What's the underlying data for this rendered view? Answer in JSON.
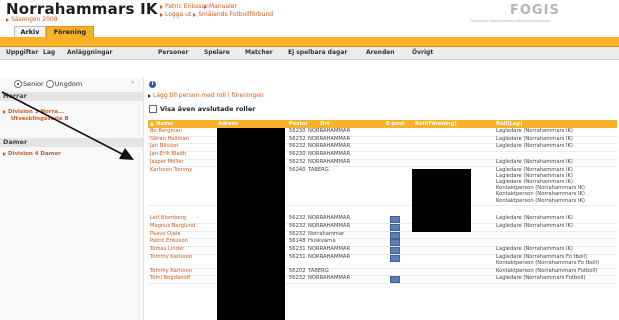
{
  "header": {
    "club_name": "Norrahammars IK",
    "season": "Säsongen 2008",
    "user_link": "Patric Eriksson",
    "manual_link": "Manualer",
    "logout_link": "Logga ut",
    "org_link": "Smålands Fotbollförbund",
    "logo": "FOGIS",
    "logo_sub": "Fotbollens Gemensamma Informationssystem"
  },
  "tabs": [
    {
      "label": "Arkiv",
      "active": false
    },
    {
      "label": "Förening",
      "active": true
    }
  ],
  "menu": [
    "Uppgifter",
    "Lag",
    "Anläggningar",
    "Personer",
    "Spelare",
    "Matcher",
    "Ej spelbara dagar",
    "Arenden",
    "Övrigt"
  ],
  "sidebar": {
    "radio_senior": "Senior",
    "radio_ungdom": "Ungdom",
    "close": "«",
    "herrar": "Herrar",
    "herrar_items": [
      "Division 3 Norra...",
      "Utvecklingsserie B"
    ],
    "damer": "Damer",
    "damer_items": [
      "Division 4 Damer"
    ]
  },
  "content": {
    "info": "i",
    "add_link": "Lägg till person med roll i föreningen",
    "show_ended": "Visa även avslutade roller"
  },
  "table": {
    "sort_icon": "▲",
    "headers": [
      "Namn",
      "Adress",
      "Postnr",
      "Ort",
      "E-post",
      "Roll(Förening)",
      "Roll(Lag)"
    ],
    "rows": [
      {
        "name": "Bo Bergman",
        "postnr": "56230",
        "ort": "NORRAHAMMAR",
        "mail": false,
        "roles": [
          "Lagledare (Norrahammars IK)"
        ]
      },
      {
        "name": "Göran Hallman",
        "postnr": "56232",
        "ort": "NORRAHAMMAR",
        "mail": false,
        "roles": [
          "Lagledare (Norrahammars IK)"
        ]
      },
      {
        "name": "Jan Nilsson",
        "postnr": "56232",
        "ort": "NORRAHAMMAR",
        "mail": false,
        "roles": [
          "Lagledare (Norrahammars IK)"
        ]
      },
      {
        "name": "Jan-Erik Bladh",
        "postnr": "56230",
        "ort": "NORRAHAMMAR",
        "mail": false,
        "roles": []
      },
      {
        "name": "Jasper Möller",
        "postnr": "56232",
        "ort": "NORRAHAMMAR",
        "mail": false,
        "roles": [
          "Lagledare (Norrahammars IK)"
        ]
      },
      {
        "name": "Karlsson Tommy",
        "postnr": "56240",
        "ort": "TABERG",
        "mail": false,
        "roles": [
          "Lagledare (Norrahammars IK)",
          "Lagledare (Norrahammars IK)",
          "Lagledare (Norrahammars IK)",
          "Kontaktperson (Norrahammars IK)",
          "Kontaktperson (Norrahammars IK)",
          "Kontaktperson (Norrahammars IK)"
        ]
      },
      {
        "name": "Leif Blomberg",
        "postnr": "56232",
        "ort": "NORRAHAMMAR",
        "mail": true,
        "roles": [
          "Lagledare (Norrahammars IK)"
        ]
      },
      {
        "name": "Magnus Berglund",
        "postnr": "56232",
        "ort": "NORRAHAMMAR",
        "mail": true,
        "roles": [
          "Lagledare (Norrahammars IK)"
        ]
      },
      {
        "name": "Paavo Ojala",
        "postnr": "56232",
        "ort": "Norrahammar",
        "mail": true,
        "roles": []
      },
      {
        "name": "Patric Eriksson",
        "postnr": "56148",
        "ort": "Huskvarna",
        "mail": true,
        "roles": []
      },
      {
        "name": "Tomas Linder",
        "postnr": "56231",
        "ort": "NORRAHAMMAR",
        "mail": true,
        "roles": [
          "Lagledare (Norrahammars IK)"
        ]
      },
      {
        "name": "Tommy Karlsson",
        "postnr": "56231",
        "ort": "NORRAHAMMAR",
        "mail": true,
        "roles": [
          "Lagledare (Norrahammars Fo tboll)",
          "Kontaktperson (Norrahammars Fo tboll)"
        ]
      },
      {
        "name": "Tommy Karlsson",
        "postnr": "56202",
        "ort": "TABERG",
        "mail": false,
        "roles": [
          "Kontaktperson (Norrahammars Fotboll)"
        ]
      },
      {
        "name": "Tomi Bogdanoff",
        "postnr": "56232",
        "ort": "NORRAHAMMAR",
        "mail": true,
        "roles": [
          "Lagledare (Norrahammars Fotboll)"
        ]
      }
    ]
  },
  "colors": {
    "accent": "#f7b228",
    "link": "#cf5a1c",
    "redaction": "#000000"
  }
}
